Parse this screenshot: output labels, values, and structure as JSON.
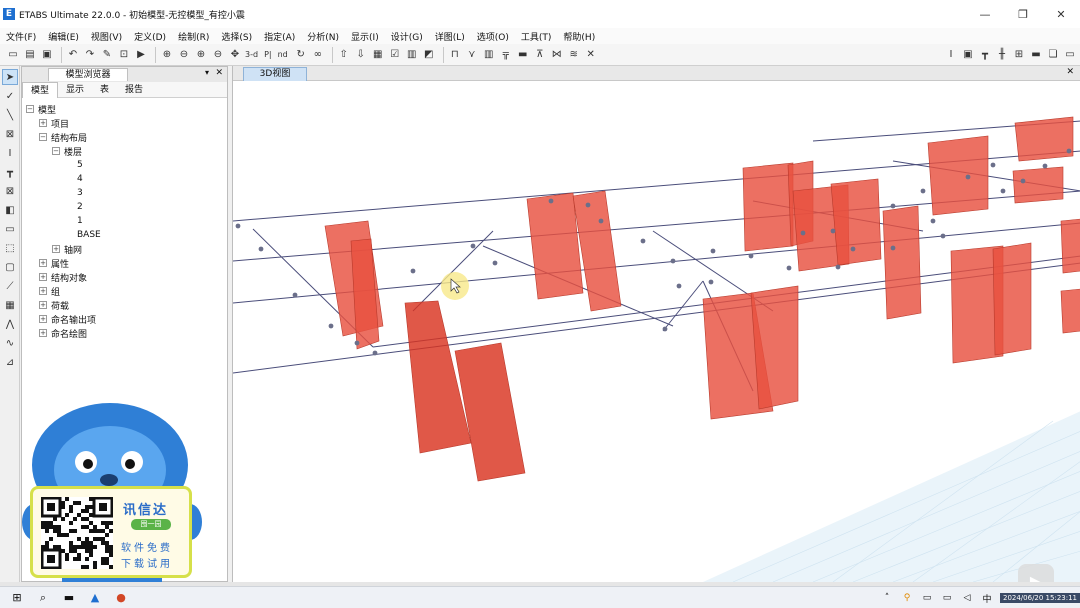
{
  "window": {
    "logo_letter": "E",
    "title": "ETABS Ultimate 22.0.0 - 初始模型-无控模型_有控小震",
    "controls": [
      "—",
      "❐",
      "✕"
    ]
  },
  "menu": [
    "文件(F)",
    "编辑(E)",
    "视图(V)",
    "定义(D)",
    "绘制(R)",
    "选择(S)",
    "指定(A)",
    "分析(N)",
    "显示(I)",
    "设计(G)",
    "详图(L)",
    "选项(O)",
    "工具(T)",
    "帮助(H)"
  ],
  "toolbar": {
    "view_3d_label": "3-d",
    "plan_label": "P|",
    "elev_label": "nd"
  },
  "explorer": {
    "title": "模型浏览器",
    "pin": "▾",
    "close": "✕",
    "tabs": [
      "模型",
      "显示",
      "表",
      "报告"
    ],
    "tree": [
      {
        "indent": 0,
        "expander": "⊟",
        "label": "模型"
      },
      {
        "indent": 1,
        "expander": "⊞",
        "label": "项目"
      },
      {
        "indent": 1,
        "expander": "⊟",
        "label": "结构布局"
      },
      {
        "indent": 2,
        "expander": "⊟",
        "label": "楼层"
      },
      {
        "indent": 3,
        "expander": "",
        "label": "5"
      },
      {
        "indent": 3,
        "expander": "",
        "label": "4"
      },
      {
        "indent": 3,
        "expander": "",
        "label": "3"
      },
      {
        "indent": 3,
        "expander": "",
        "label": "2"
      },
      {
        "indent": 3,
        "expander": "",
        "label": "1"
      },
      {
        "indent": 3,
        "expander": "",
        "label": "BASE"
      },
      {
        "indent": 2,
        "expander": "⊞",
        "label": "轴网"
      },
      {
        "indent": 1,
        "expander": "⊞",
        "label": "属性"
      },
      {
        "indent": 1,
        "expander": "⊞",
        "label": "结构对象"
      },
      {
        "indent": 1,
        "expander": "⊞",
        "label": "组"
      },
      {
        "indent": 1,
        "expander": "⊞",
        "label": "荷载"
      },
      {
        "indent": 1,
        "expander": "⊞",
        "label": "命名输出项"
      },
      {
        "indent": 1,
        "expander": "⊞",
        "label": "命名绘图"
      }
    ]
  },
  "viewport": {
    "tab": "3D视图",
    "close": "✕",
    "wall_color": "#e8513f",
    "wall_color_dark": "#d93320",
    "frame_color": "#4a4d7a"
  },
  "ad": {
    "brand": "讯信达",
    "pill": "囤一园",
    "line1": "软件免费",
    "line2": "下载试用"
  },
  "taskbar": {
    "clock": "2024/06/20 15:23:11"
  }
}
